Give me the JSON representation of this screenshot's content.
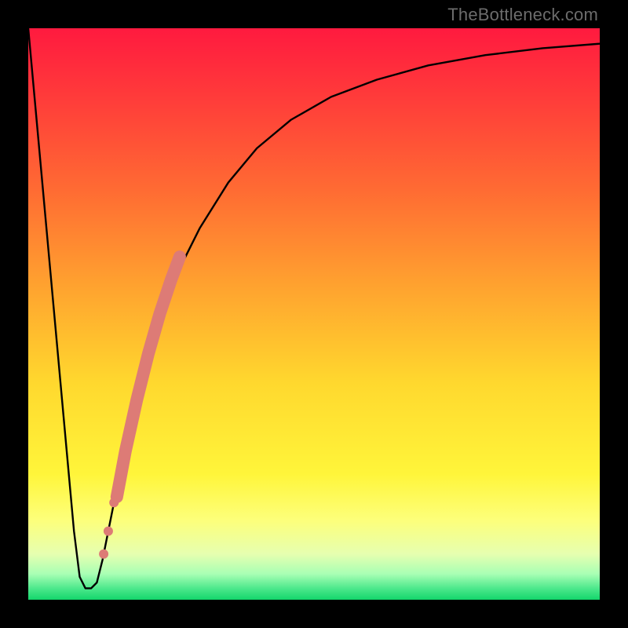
{
  "watermark": {
    "text": "TheBottleneck.com"
  },
  "gradient": {
    "stops": [
      {
        "offset": 0.0,
        "color": "#ff1a3f"
      },
      {
        "offset": 0.12,
        "color": "#ff3b3a"
      },
      {
        "offset": 0.28,
        "color": "#ff6a33"
      },
      {
        "offset": 0.45,
        "color": "#ffa22f"
      },
      {
        "offset": 0.62,
        "color": "#ffd82e"
      },
      {
        "offset": 0.78,
        "color": "#fff53a"
      },
      {
        "offset": 0.86,
        "color": "#fdff7a"
      },
      {
        "offset": 0.92,
        "color": "#e6ffb0"
      },
      {
        "offset": 0.955,
        "color": "#a8ffb4"
      },
      {
        "offset": 0.98,
        "color": "#4de88c"
      },
      {
        "offset": 1.0,
        "color": "#13d66b"
      }
    ]
  },
  "chart_data": {
    "type": "line",
    "title": "",
    "xlabel": "",
    "ylabel": "",
    "xlim": [
      0,
      100
    ],
    "ylim": [
      0,
      100
    ],
    "grid": false,
    "series": [
      {
        "name": "bottleneck-curve",
        "x": [
          0,
          2,
          4,
          6,
          8,
          9,
          10,
          11,
          12,
          13,
          14,
          16,
          18,
          20,
          23,
          26,
          30,
          35,
          40,
          46,
          53,
          61,
          70,
          80,
          90,
          100
        ],
        "y": [
          100,
          78,
          56,
          34,
          12,
          4,
          2,
          2,
          3,
          7,
          12,
          22,
          31,
          39,
          49,
          57,
          65,
          73,
          79,
          84,
          88,
          91,
          93.5,
          95.3,
          96.5,
          97.3
        ]
      }
    ],
    "highlight_segment": {
      "note": "salmon thick stroke along rising limb",
      "x": [
        15.5,
        17,
        19,
        21,
        23,
        25,
        26.5
      ],
      "y": [
        18,
        26,
        35,
        43,
        50,
        56,
        60
      ]
    },
    "highlight_dots": {
      "note": "isolated salmon dots below the thick segment",
      "points": [
        {
          "x": 13.2,
          "y": 8
        },
        {
          "x": 14.0,
          "y": 12
        },
        {
          "x": 15.0,
          "y": 17
        }
      ],
      "r": 6
    }
  }
}
